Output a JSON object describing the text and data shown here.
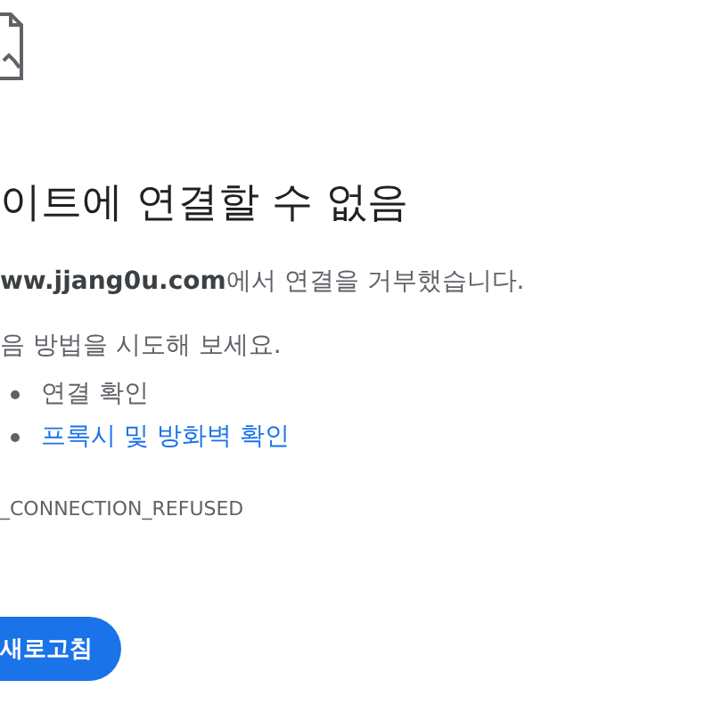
{
  "heading": "이트에 연결할 수 없음",
  "message": {
    "host": "ww.jjang0u.com",
    "rest": "에서 연결을 거부했습니다."
  },
  "suggestions_intro": "음 방법을 시도해 보세요.",
  "suggestions": [
    {
      "text": "연결 확인",
      "kind": "text"
    },
    {
      "text": "프록시 및 방화벽 확인",
      "kind": "link"
    }
  ],
  "error_code": "_CONNECTION_REFUSED",
  "buttons": [
    "새로고침"
  ]
}
